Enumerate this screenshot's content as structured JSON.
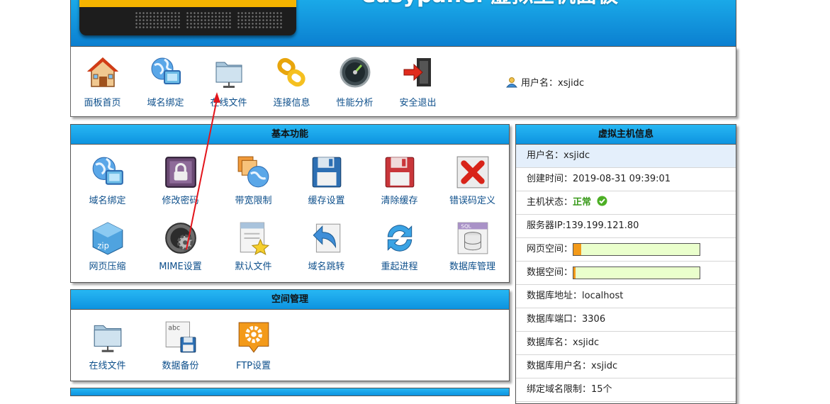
{
  "banner": {
    "title": "easypanel 虚拟主机面板"
  },
  "topnav": {
    "items": [
      {
        "label": "面板首页",
        "icon": "home-icon"
      },
      {
        "label": "域名绑定",
        "icon": "globe-icon"
      },
      {
        "label": "在线文件",
        "icon": "folder-icon"
      },
      {
        "label": "连接信息",
        "icon": "chain-link-icon"
      },
      {
        "label": "性能分析",
        "icon": "gauge-icon"
      },
      {
        "label": "安全退出",
        "icon": "exit-door-icon"
      }
    ],
    "user_label": "用户名：xsjidc"
  },
  "basic": {
    "title": "基本功能",
    "items": [
      {
        "label": "域名绑定",
        "icon": "globe-icon"
      },
      {
        "label": "修改密码",
        "icon": "padlock-icon"
      },
      {
        "label": "带宽限制",
        "icon": "bandwidth-globe-icon"
      },
      {
        "label": "缓存设置",
        "icon": "floppy-disk-icon"
      },
      {
        "label": "清除缓存",
        "icon": "floppy-delete-icon"
      },
      {
        "label": "错误码定义",
        "icon": "red-x-icon"
      },
      {
        "label": "网页压缩",
        "icon": "zip-cube-icon"
      },
      {
        "label": "MIME设置",
        "icon": "gear-icon"
      },
      {
        "label": "默认文件",
        "icon": "document-star-icon"
      },
      {
        "label": "域名跳转",
        "icon": "redirect-arrow-icon"
      },
      {
        "label": "重起进程",
        "icon": "refresh-icon"
      },
      {
        "label": "数据库管理",
        "icon": "sql-database-icon"
      }
    ]
  },
  "space": {
    "title": "空间管理",
    "items": [
      {
        "label": "在线文件",
        "icon": "folder-icon"
      },
      {
        "label": "数据备份",
        "icon": "backup-icon"
      },
      {
        "label": "FTP设置",
        "icon": "ftp-gear-icon"
      }
    ]
  },
  "hostinfo": {
    "title": "虚拟主机信息",
    "username": "用户名：xsjidc",
    "created": "创建时间：2019-08-31 09:39:01",
    "status_label": "主机状态：",
    "status_value": "正常",
    "server_ip": "服务器IP:139.199.121.80",
    "web_space_label": "网页空间：",
    "web_space_fraction": 0.06,
    "db_space_label": "数据空间：",
    "db_space_fraction": 0.015,
    "db_host": "数据库地址：localhost",
    "db_port": "数据库端口：3306",
    "db_name": "数据库名：xsjidc",
    "db_user": "数据库用户名：xsjidc",
    "domain_limit": "绑定域名限制：15个"
  },
  "colors": {
    "accent": "#0d93e0",
    "link": "#0d4f8b",
    "ok": "#3a9a1b",
    "annotation": "#e3141b"
  }
}
